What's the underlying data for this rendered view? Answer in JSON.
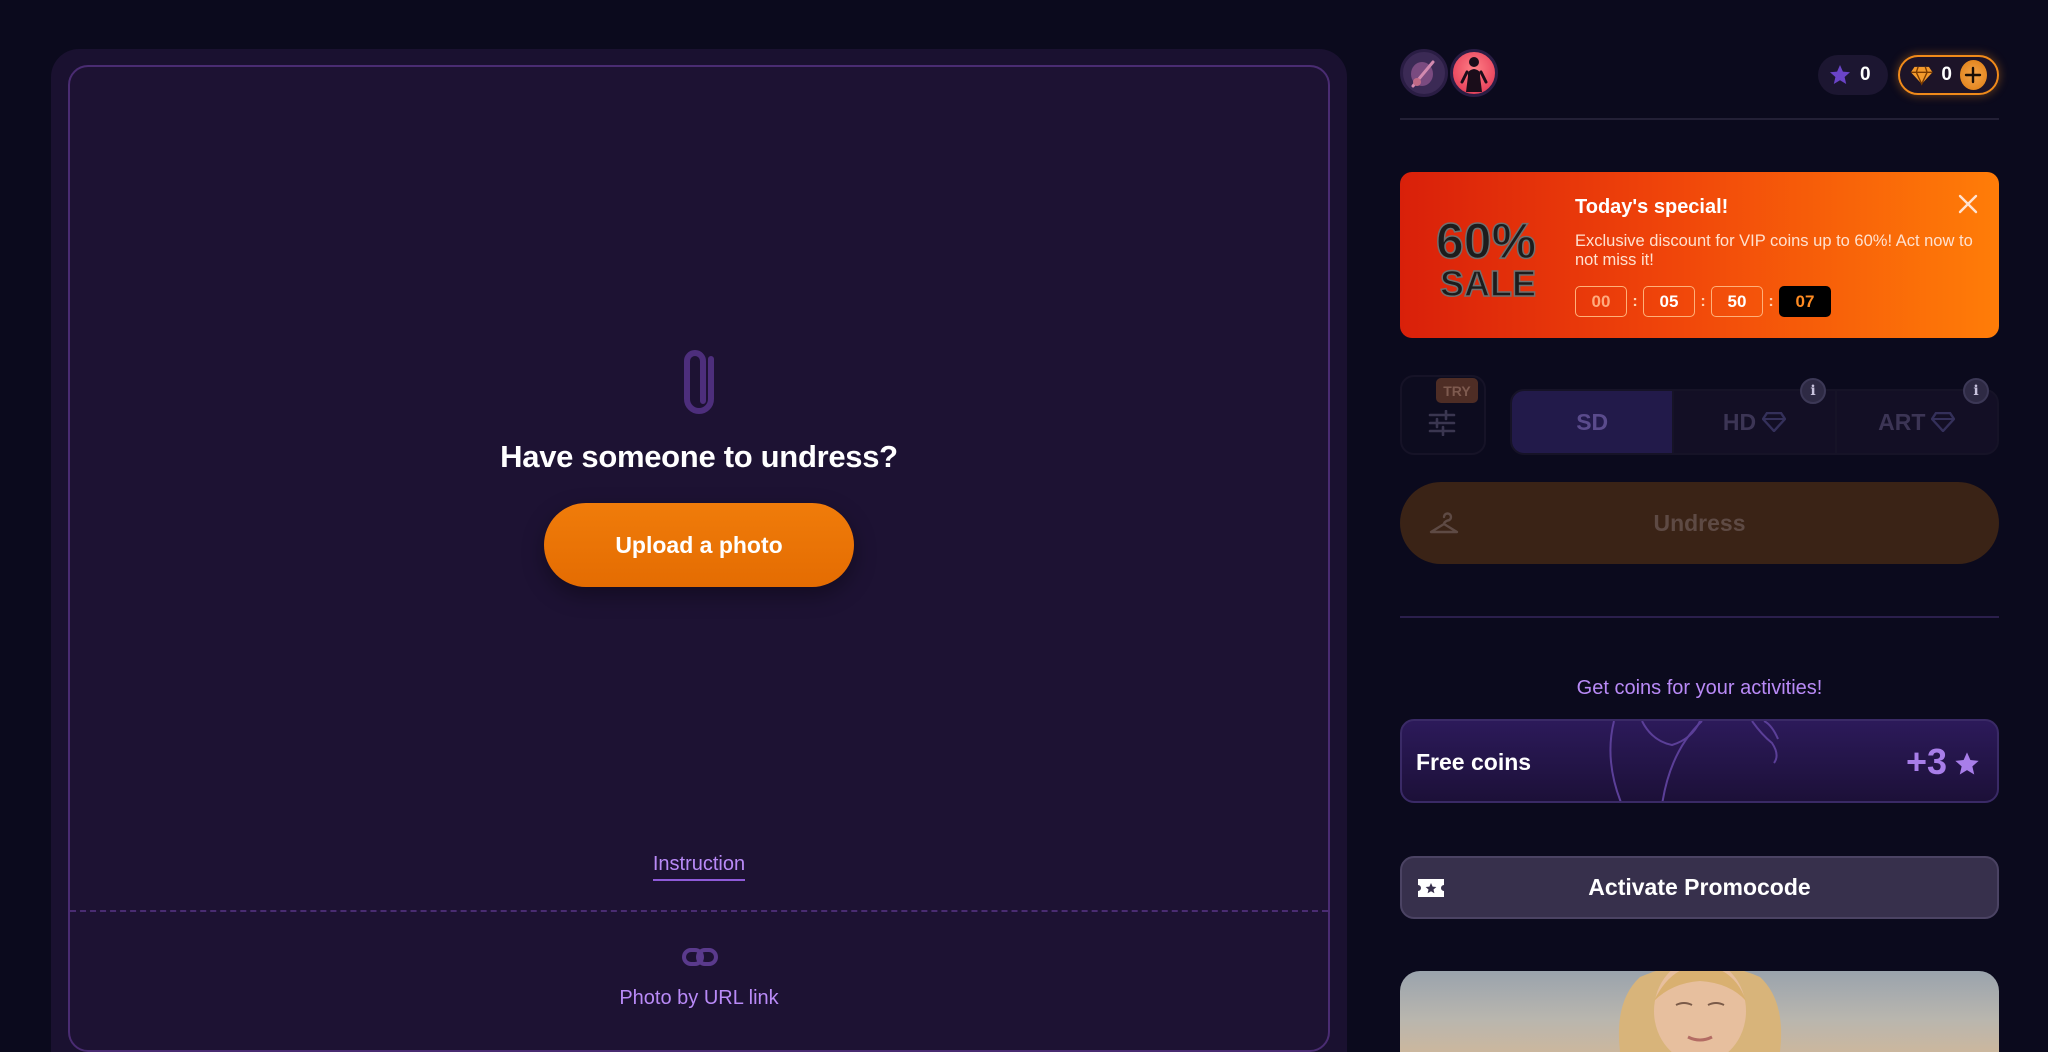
{
  "upload": {
    "title": "Have someone to undress?",
    "upload_button": "Upload a photo",
    "instruction_link": "Instruction",
    "url_link": "Photo by URL link"
  },
  "header": {
    "stars_count": "0",
    "gems_count": "0"
  },
  "promo": {
    "badge_text_top": "60%",
    "badge_text_bottom": "SALE",
    "title": "Today's special!",
    "text": "Exclusive discount for VIP coins up to 60%! Act now to not miss it!",
    "timer": [
      "00",
      "05",
      "50",
      "07"
    ]
  },
  "quality": {
    "try_badge": "TRY",
    "options": [
      "SD",
      "HD",
      "ART"
    ],
    "info_glyph": "i"
  },
  "actions": {
    "undress": "Undress",
    "coins_caption": "Get coins for your activities!",
    "free_coins_label": "Free coins",
    "free_coins_amount": "+3",
    "promocode": "Activate Promocode"
  },
  "icons": {
    "paperclip": "paperclip-icon",
    "link": "link-icon",
    "star": "star-icon",
    "gem": "gem-icon",
    "plus": "plus-icon",
    "close": "close-icon",
    "settings": "sliders-icon",
    "hanger": "hanger-icon",
    "ticket": "ticket-icon"
  },
  "colors": {
    "background": "#0b0a1d",
    "panel": "#1a1130",
    "accent_orange": "#e8720a",
    "accent_purple": "#b98af7"
  }
}
